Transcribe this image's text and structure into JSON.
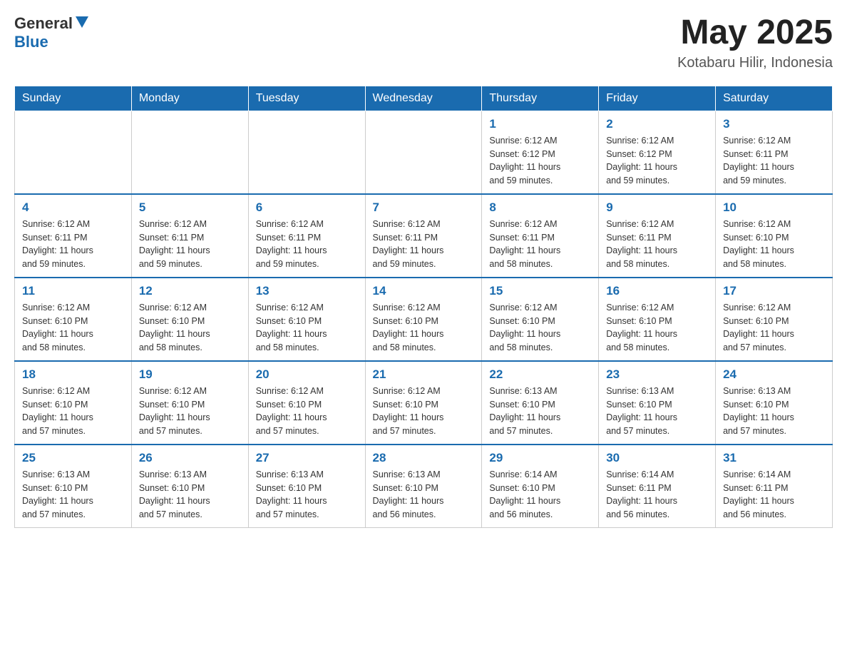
{
  "header": {
    "logo_general": "General",
    "logo_blue": "Blue",
    "month_year": "May 2025",
    "location": "Kotabaru Hilir, Indonesia"
  },
  "weekdays": [
    "Sunday",
    "Monday",
    "Tuesday",
    "Wednesday",
    "Thursday",
    "Friday",
    "Saturday"
  ],
  "weeks": [
    [
      {
        "day": "",
        "info": ""
      },
      {
        "day": "",
        "info": ""
      },
      {
        "day": "",
        "info": ""
      },
      {
        "day": "",
        "info": ""
      },
      {
        "day": "1",
        "info": "Sunrise: 6:12 AM\nSunset: 6:12 PM\nDaylight: 11 hours\nand 59 minutes."
      },
      {
        "day": "2",
        "info": "Sunrise: 6:12 AM\nSunset: 6:12 PM\nDaylight: 11 hours\nand 59 minutes."
      },
      {
        "day": "3",
        "info": "Sunrise: 6:12 AM\nSunset: 6:11 PM\nDaylight: 11 hours\nand 59 minutes."
      }
    ],
    [
      {
        "day": "4",
        "info": "Sunrise: 6:12 AM\nSunset: 6:11 PM\nDaylight: 11 hours\nand 59 minutes."
      },
      {
        "day": "5",
        "info": "Sunrise: 6:12 AM\nSunset: 6:11 PM\nDaylight: 11 hours\nand 59 minutes."
      },
      {
        "day": "6",
        "info": "Sunrise: 6:12 AM\nSunset: 6:11 PM\nDaylight: 11 hours\nand 59 minutes."
      },
      {
        "day": "7",
        "info": "Sunrise: 6:12 AM\nSunset: 6:11 PM\nDaylight: 11 hours\nand 59 minutes."
      },
      {
        "day": "8",
        "info": "Sunrise: 6:12 AM\nSunset: 6:11 PM\nDaylight: 11 hours\nand 58 minutes."
      },
      {
        "day": "9",
        "info": "Sunrise: 6:12 AM\nSunset: 6:11 PM\nDaylight: 11 hours\nand 58 minutes."
      },
      {
        "day": "10",
        "info": "Sunrise: 6:12 AM\nSunset: 6:10 PM\nDaylight: 11 hours\nand 58 minutes."
      }
    ],
    [
      {
        "day": "11",
        "info": "Sunrise: 6:12 AM\nSunset: 6:10 PM\nDaylight: 11 hours\nand 58 minutes."
      },
      {
        "day": "12",
        "info": "Sunrise: 6:12 AM\nSunset: 6:10 PM\nDaylight: 11 hours\nand 58 minutes."
      },
      {
        "day": "13",
        "info": "Sunrise: 6:12 AM\nSunset: 6:10 PM\nDaylight: 11 hours\nand 58 minutes."
      },
      {
        "day": "14",
        "info": "Sunrise: 6:12 AM\nSunset: 6:10 PM\nDaylight: 11 hours\nand 58 minutes."
      },
      {
        "day": "15",
        "info": "Sunrise: 6:12 AM\nSunset: 6:10 PM\nDaylight: 11 hours\nand 58 minutes."
      },
      {
        "day": "16",
        "info": "Sunrise: 6:12 AM\nSunset: 6:10 PM\nDaylight: 11 hours\nand 58 minutes."
      },
      {
        "day": "17",
        "info": "Sunrise: 6:12 AM\nSunset: 6:10 PM\nDaylight: 11 hours\nand 57 minutes."
      }
    ],
    [
      {
        "day": "18",
        "info": "Sunrise: 6:12 AM\nSunset: 6:10 PM\nDaylight: 11 hours\nand 57 minutes."
      },
      {
        "day": "19",
        "info": "Sunrise: 6:12 AM\nSunset: 6:10 PM\nDaylight: 11 hours\nand 57 minutes."
      },
      {
        "day": "20",
        "info": "Sunrise: 6:12 AM\nSunset: 6:10 PM\nDaylight: 11 hours\nand 57 minutes."
      },
      {
        "day": "21",
        "info": "Sunrise: 6:12 AM\nSunset: 6:10 PM\nDaylight: 11 hours\nand 57 minutes."
      },
      {
        "day": "22",
        "info": "Sunrise: 6:13 AM\nSunset: 6:10 PM\nDaylight: 11 hours\nand 57 minutes."
      },
      {
        "day": "23",
        "info": "Sunrise: 6:13 AM\nSunset: 6:10 PM\nDaylight: 11 hours\nand 57 minutes."
      },
      {
        "day": "24",
        "info": "Sunrise: 6:13 AM\nSunset: 6:10 PM\nDaylight: 11 hours\nand 57 minutes."
      }
    ],
    [
      {
        "day": "25",
        "info": "Sunrise: 6:13 AM\nSunset: 6:10 PM\nDaylight: 11 hours\nand 57 minutes."
      },
      {
        "day": "26",
        "info": "Sunrise: 6:13 AM\nSunset: 6:10 PM\nDaylight: 11 hours\nand 57 minutes."
      },
      {
        "day": "27",
        "info": "Sunrise: 6:13 AM\nSunset: 6:10 PM\nDaylight: 11 hours\nand 57 minutes."
      },
      {
        "day": "28",
        "info": "Sunrise: 6:13 AM\nSunset: 6:10 PM\nDaylight: 11 hours\nand 56 minutes."
      },
      {
        "day": "29",
        "info": "Sunrise: 6:14 AM\nSunset: 6:10 PM\nDaylight: 11 hours\nand 56 minutes."
      },
      {
        "day": "30",
        "info": "Sunrise: 6:14 AM\nSunset: 6:11 PM\nDaylight: 11 hours\nand 56 minutes."
      },
      {
        "day": "31",
        "info": "Sunrise: 6:14 AM\nSunset: 6:11 PM\nDaylight: 11 hours\nand 56 minutes."
      }
    ]
  ]
}
